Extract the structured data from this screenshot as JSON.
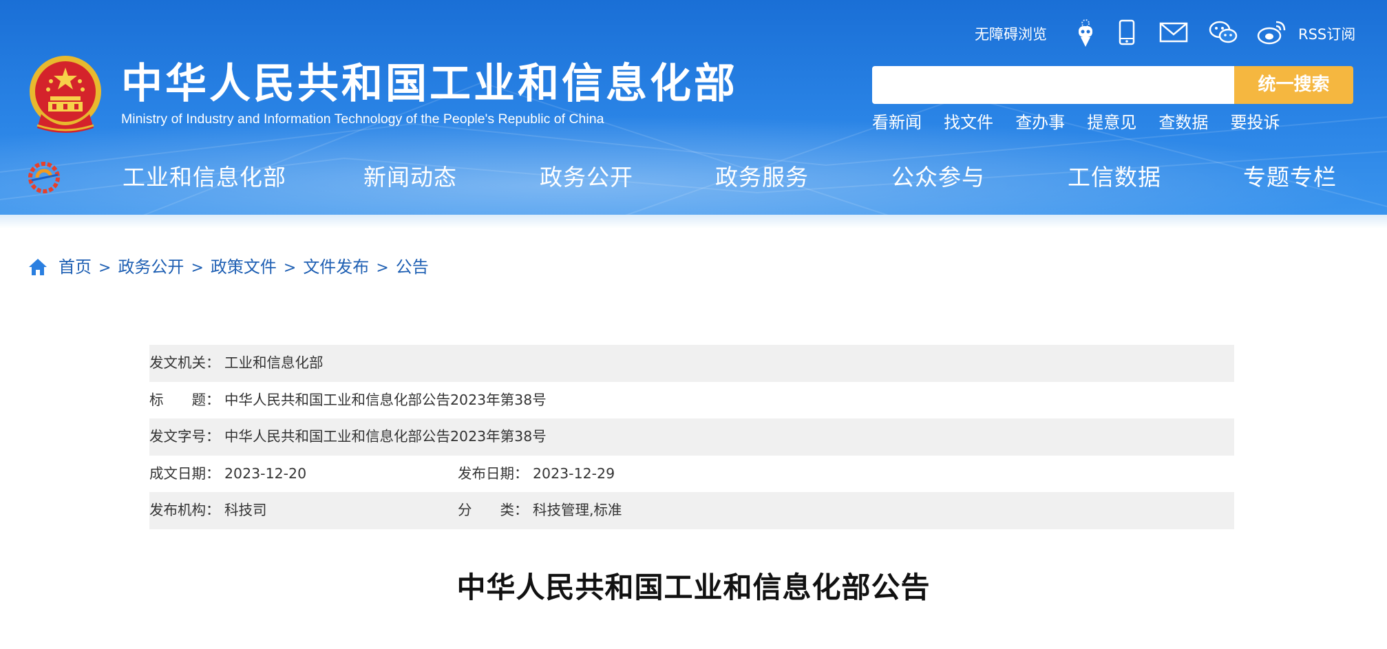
{
  "header": {
    "site_title": "中华人民共和国工业和信息化部",
    "site_subtitle": "Ministry of Industry and Information Technology of the People's Republic of China",
    "accessibility_label": "无障碍浏览",
    "rss_label": "RSS订阅",
    "icons": [
      "robot-assistant-icon",
      "mobile-icon",
      "mail-icon",
      "wechat-icon",
      "weibo-icon"
    ],
    "search": {
      "placeholder": "",
      "button_label": "统一搜索"
    },
    "quick_links": [
      "看新闻",
      "找文件",
      "查办事",
      "提意见",
      "查数据",
      "要投诉"
    ]
  },
  "nav": {
    "items": [
      "工业和信息化部",
      "新闻动态",
      "政务公开",
      "政务服务",
      "公众参与",
      "工信数据",
      "专题专栏"
    ]
  },
  "breadcrumb": [
    "首页",
    "政务公开",
    "政策文件",
    "文件发布",
    "公告"
  ],
  "meta": {
    "issuer_label": "发文机关：",
    "issuer": "工业和信息化部",
    "title_label": "标　　题：",
    "title": "中华人民共和国工业和信息化部公告2023年第38号",
    "doc_no_label": "发文字号：",
    "doc_no": "中华人民共和国工业和信息化部公告2023年第38号",
    "created_label": "成文日期：",
    "created": "2023-12-20",
    "published_label": "发布日期：",
    "published": "2023-12-29",
    "org_label": "发布机构：",
    "org": "科技司",
    "category_label": "分　　类：",
    "category": "科技管理,标准"
  },
  "document_title": "中华人民共和国工业和信息化部公告",
  "colors": {
    "header_blue": "#1a6fd6",
    "search_button": "#f5b740",
    "breadcrumb_link": "#1e5fb3",
    "meta_row_shade": "#f0f0f0"
  }
}
